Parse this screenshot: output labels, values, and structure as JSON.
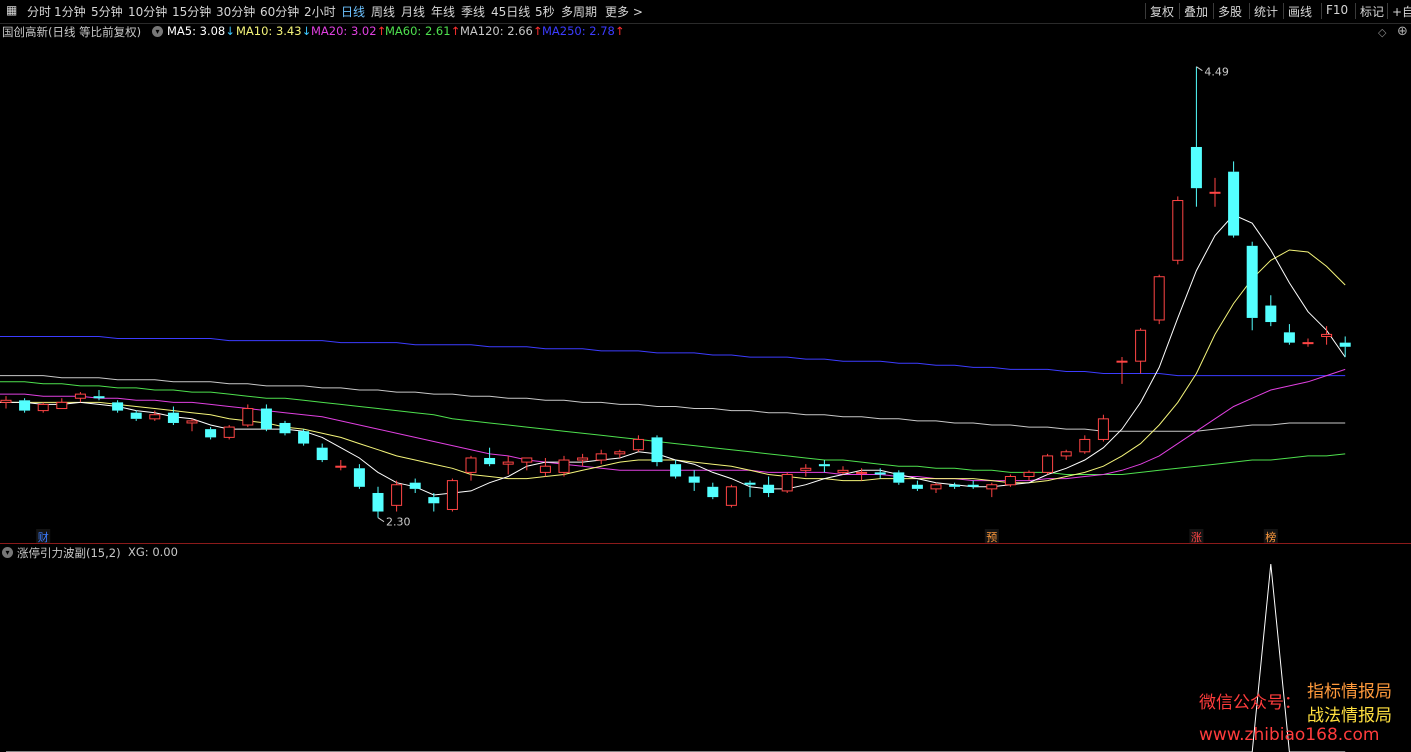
{
  "toolbar": {
    "left": [
      "分时",
      "1分钟",
      "5分钟",
      "10分钟",
      "15分钟",
      "30分钟",
      "60分钟",
      "2小时",
      "日线",
      "周线",
      "月线",
      "年线",
      "季线",
      "45日线",
      "5秒",
      "多周期",
      "更多 >"
    ],
    "active": "日线",
    "right": [
      "复权",
      "叠加",
      "多股",
      "统计",
      "画线",
      "F10",
      "标记",
      "+自"
    ]
  },
  "header": {
    "title": "国创高新(日线 等比前复权)",
    "ma": [
      {
        "label": "MA5: 3.08",
        "arrow": "↓",
        "color": "#ffffff"
      },
      {
        "label": "MA10: 3.43",
        "arrow": "↓",
        "color": "#f4f47a"
      },
      {
        "label": "MA20: 3.02",
        "arrow": "↑",
        "color": "#e040e0"
      },
      {
        "label": "MA60: 2.61",
        "arrow": "↑",
        "color": "#4ee04e"
      },
      {
        "label": "MA120: 2.66",
        "arrow": "↑",
        "color": "#c8c8c8"
      },
      {
        "label": "MA250: 2.78",
        "arrow": "↑",
        "color": "#3c3cff"
      }
    ],
    "arrow_up_color": "#ff3030",
    "arrow_down_color": "#3cc8ff"
  },
  "sub_header": {
    "title": "涨停引力波副(15,2)",
    "value": "XG: 0.00"
  },
  "colors": {
    "up": "#ff4545",
    "down": "#54ffff",
    "ma5": "#ffffff",
    "ma10": "#f4f47a",
    "ma20": "#e040e0",
    "ma60": "#4ee04e",
    "ma120": "#c8c8c8",
    "ma250": "#3c3cff"
  },
  "chart_data": {
    "type": "candlestick",
    "price_labels": {
      "high": "4.49",
      "low": "2.30"
    },
    "events": [
      {
        "index": 2,
        "label": "财",
        "color": "#3c7cff"
      },
      {
        "index": 53,
        "label": "预",
        "color": "#ff9a3c"
      },
      {
        "index": 64,
        "label": "涨",
        "color": "#ff4545"
      },
      {
        "index": 68,
        "label": "榜",
        "color": "#ff9a3c"
      }
    ],
    "candles": [
      [
        2.86,
        2.89,
        2.83,
        2.87
      ],
      [
        2.87,
        2.88,
        2.81,
        2.82
      ],
      [
        2.82,
        2.86,
        2.81,
        2.85
      ],
      [
        2.83,
        2.88,
        2.83,
        2.86
      ],
      [
        2.88,
        2.91,
        2.86,
        2.9
      ],
      [
        2.89,
        2.92,
        2.87,
        2.88
      ],
      [
        2.86,
        2.87,
        2.81,
        2.82
      ],
      [
        2.81,
        2.82,
        2.77,
        2.78
      ],
      [
        2.78,
        2.82,
        2.77,
        2.8
      ],
      [
        2.81,
        2.84,
        2.75,
        2.76
      ],
      [
        2.76,
        2.78,
        2.72,
        2.77
      ],
      [
        2.73,
        2.74,
        2.68,
        2.69
      ],
      [
        2.69,
        2.75,
        2.68,
        2.74
      ],
      [
        2.75,
        2.85,
        2.74,
        2.83
      ],
      [
        2.83,
        2.85,
        2.72,
        2.73
      ],
      [
        2.76,
        2.77,
        2.7,
        2.71
      ],
      [
        2.72,
        2.73,
        2.65,
        2.66
      ],
      [
        2.64,
        2.66,
        2.57,
        2.58
      ],
      [
        2.55,
        2.58,
        2.53,
        2.55
      ],
      [
        2.54,
        2.56,
        2.44,
        2.45
      ],
      [
        2.42,
        2.45,
        2.3,
        2.33
      ],
      [
        2.36,
        2.48,
        2.33,
        2.46
      ],
      [
        2.47,
        2.49,
        2.42,
        2.44
      ],
      [
        2.4,
        2.42,
        2.33,
        2.37
      ],
      [
        2.34,
        2.49,
        2.33,
        2.48
      ],
      [
        2.52,
        2.6,
        2.48,
        2.59
      ],
      [
        2.59,
        2.64,
        2.55,
        2.56
      ],
      [
        2.56,
        2.6,
        2.51,
        2.57
      ],
      [
        2.57,
        2.59,
        2.53,
        2.59
      ],
      [
        2.52,
        2.59,
        2.5,
        2.55
      ],
      [
        2.52,
        2.6,
        2.5,
        2.58
      ],
      [
        2.58,
        2.61,
        2.55,
        2.59
      ],
      [
        2.58,
        2.63,
        2.56,
        2.61
      ],
      [
        2.61,
        2.63,
        2.59,
        2.62
      ],
      [
        2.63,
        2.7,
        2.62,
        2.68
      ],
      [
        2.69,
        2.7,
        2.55,
        2.57
      ],
      [
        2.56,
        2.58,
        2.49,
        2.5
      ],
      [
        2.5,
        2.53,
        2.43,
        2.47
      ],
      [
        2.45,
        2.47,
        2.39,
        2.4
      ],
      [
        2.36,
        2.46,
        2.35,
        2.45
      ],
      [
        2.47,
        2.48,
        2.4,
        2.46
      ],
      [
        2.46,
        2.5,
        2.4,
        2.42
      ],
      [
        2.43,
        2.52,
        2.42,
        2.51
      ],
      [
        2.53,
        2.56,
        2.5,
        2.54
      ],
      [
        2.56,
        2.58,
        2.52,
        2.55
      ],
      [
        2.52,
        2.55,
        2.51,
        2.53
      ],
      [
        2.52,
        2.54,
        2.48,
        2.52
      ],
      [
        2.52,
        2.54,
        2.49,
        2.51
      ],
      [
        2.52,
        2.53,
        2.46,
        2.47
      ],
      [
        2.46,
        2.48,
        2.43,
        2.44
      ],
      [
        2.44,
        2.47,
        2.42,
        2.46
      ],
      [
        2.46,
        2.47,
        2.44,
        2.45
      ],
      [
        2.46,
        2.48,
        2.44,
        2.45
      ],
      [
        2.44,
        2.47,
        2.4,
        2.46
      ],
      [
        2.46,
        2.51,
        2.45,
        2.5
      ],
      [
        2.5,
        2.53,
        2.48,
        2.52
      ],
      [
        2.52,
        2.61,
        2.51,
        2.6
      ],
      [
        2.6,
        2.63,
        2.58,
        2.62
      ],
      [
        2.62,
        2.7,
        2.61,
        2.68
      ],
      [
        2.68,
        2.8,
        2.67,
        2.78
      ],
      [
        3.06,
        3.08,
        2.95,
        3.06
      ],
      [
        3.06,
        3.22,
        3.0,
        3.21
      ],
      [
        3.26,
        3.48,
        3.24,
        3.47
      ],
      [
        3.55,
        3.86,
        3.53,
        3.84
      ],
      [
        4.1,
        4.49,
        3.81,
        3.9
      ],
      [
        3.88,
        3.95,
        3.81,
        3.88
      ],
      [
        3.98,
        4.03,
        3.66,
        3.67
      ],
      [
        3.62,
        3.64,
        3.21,
        3.27
      ],
      [
        3.33,
        3.38,
        3.23,
        3.25
      ],
      [
        3.2,
        3.24,
        3.14,
        3.15
      ],
      [
        3.15,
        3.17,
        3.13,
        3.15
      ],
      [
        3.18,
        3.23,
        3.14,
        3.19
      ],
      [
        3.15,
        3.18,
        3.08,
        3.13
      ]
    ],
    "ma_series": {
      "MA5": [
        2.86,
        2.86,
        2.85,
        2.85,
        2.86,
        2.85,
        2.84,
        2.82,
        2.81,
        2.79,
        2.78,
        2.75,
        2.73,
        2.73,
        2.73,
        2.73,
        2.72,
        2.69,
        2.64,
        2.59,
        2.52,
        2.47,
        2.45,
        2.41,
        2.42,
        2.43,
        2.47,
        2.5,
        2.55,
        2.57,
        2.57,
        2.57,
        2.58,
        2.59,
        2.62,
        2.61,
        2.58,
        2.56,
        2.52,
        2.49,
        2.45,
        2.44,
        2.44,
        2.46,
        2.49,
        2.51,
        2.53,
        2.53,
        2.51,
        2.49,
        2.47,
        2.46,
        2.45,
        2.45,
        2.46,
        2.47,
        2.51,
        2.54,
        2.58,
        2.64,
        2.73,
        2.86,
        3.03,
        3.27,
        3.5,
        3.67,
        3.77,
        3.73,
        3.6,
        3.44,
        3.3,
        3.21,
        3.08
      ],
      "MA10": [
        2.86,
        2.86,
        2.86,
        2.86,
        2.86,
        2.86,
        2.85,
        2.84,
        2.83,
        2.82,
        2.81,
        2.8,
        2.78,
        2.77,
        2.76,
        2.74,
        2.73,
        2.71,
        2.69,
        2.66,
        2.63,
        2.6,
        2.58,
        2.56,
        2.54,
        2.51,
        2.5,
        2.49,
        2.49,
        2.5,
        2.51,
        2.53,
        2.55,
        2.57,
        2.58,
        2.58,
        2.58,
        2.57,
        2.56,
        2.55,
        2.53,
        2.51,
        2.5,
        2.49,
        2.49,
        2.48,
        2.48,
        2.49,
        2.49,
        2.49,
        2.49,
        2.49,
        2.49,
        2.48,
        2.47,
        2.47,
        2.48,
        2.5,
        2.52,
        2.55,
        2.6,
        2.66,
        2.75,
        2.86,
        3.0,
        3.19,
        3.34,
        3.46,
        3.55,
        3.6,
        3.59,
        3.52,
        3.43
      ],
      "MA20": [
        2.9,
        2.9,
        2.89,
        2.89,
        2.89,
        2.88,
        2.88,
        2.87,
        2.87,
        2.86,
        2.86,
        2.85,
        2.84,
        2.83,
        2.82,
        2.81,
        2.8,
        2.79,
        2.77,
        2.75,
        2.73,
        2.71,
        2.69,
        2.67,
        2.65,
        2.63,
        2.61,
        2.6,
        2.58,
        2.57,
        2.56,
        2.55,
        2.54,
        2.53,
        2.53,
        2.53,
        2.53,
        2.53,
        2.53,
        2.53,
        2.53,
        2.52,
        2.52,
        2.52,
        2.52,
        2.51,
        2.51,
        2.51,
        2.5,
        2.5,
        2.49,
        2.49,
        2.48,
        2.48,
        2.48,
        2.48,
        2.49,
        2.49,
        2.5,
        2.51,
        2.53,
        2.56,
        2.6,
        2.66,
        2.72,
        2.78,
        2.84,
        2.88,
        2.92,
        2.94,
        2.96,
        2.99,
        3.02
      ],
      "MA60": [
        2.96,
        2.96,
        2.95,
        2.95,
        2.94,
        2.94,
        2.93,
        2.93,
        2.92,
        2.92,
        2.91,
        2.91,
        2.9,
        2.89,
        2.88,
        2.88,
        2.87,
        2.86,
        2.85,
        2.84,
        2.83,
        2.82,
        2.81,
        2.8,
        2.78,
        2.77,
        2.76,
        2.75,
        2.74,
        2.73,
        2.72,
        2.71,
        2.7,
        2.69,
        2.68,
        2.67,
        2.66,
        2.65,
        2.64,
        2.63,
        2.62,
        2.61,
        2.6,
        2.59,
        2.58,
        2.58,
        2.57,
        2.56,
        2.55,
        2.55,
        2.54,
        2.54,
        2.53,
        2.53,
        2.52,
        2.52,
        2.52,
        2.51,
        2.51,
        2.51,
        2.51,
        2.52,
        2.53,
        2.54,
        2.55,
        2.56,
        2.57,
        2.58,
        2.58,
        2.59,
        2.6,
        2.6,
        2.61
      ],
      "MA120": [
        2.99,
        2.99,
        2.99,
        2.98,
        2.98,
        2.98,
        2.97,
        2.97,
        2.97,
        2.96,
        2.96,
        2.96,
        2.95,
        2.95,
        2.94,
        2.94,
        2.94,
        2.93,
        2.93,
        2.92,
        2.92,
        2.91,
        2.91,
        2.9,
        2.9,
        2.89,
        2.89,
        2.88,
        2.88,
        2.87,
        2.87,
        2.86,
        2.86,
        2.85,
        2.85,
        2.84,
        2.84,
        2.83,
        2.83,
        2.82,
        2.82,
        2.81,
        2.81,
        2.8,
        2.8,
        2.79,
        2.79,
        2.78,
        2.78,
        2.77,
        2.77,
        2.76,
        2.76,
        2.75,
        2.75,
        2.74,
        2.74,
        2.73,
        2.73,
        2.72,
        2.72,
        2.72,
        2.72,
        2.72,
        2.72,
        2.73,
        2.74,
        2.75,
        2.75,
        2.76,
        2.76,
        2.76,
        2.76
      ],
      "MA250": [
        3.18,
        3.18,
        3.18,
        3.18,
        3.18,
        3.18,
        3.17,
        3.17,
        3.17,
        3.17,
        3.17,
        3.17,
        3.16,
        3.16,
        3.16,
        3.16,
        3.16,
        3.16,
        3.15,
        3.15,
        3.15,
        3.15,
        3.14,
        3.14,
        3.14,
        3.14,
        3.13,
        3.13,
        3.13,
        3.12,
        3.12,
        3.12,
        3.11,
        3.11,
        3.11,
        3.1,
        3.1,
        3.1,
        3.09,
        3.09,
        3.08,
        3.08,
        3.08,
        3.07,
        3.07,
        3.06,
        3.06,
        3.06,
        3.05,
        3.05,
        3.04,
        3.04,
        3.03,
        3.03,
        3.02,
        3.02,
        3.02,
        3.01,
        3.01,
        3.0,
        3.0,
        3.0,
        3.0,
        2.99,
        2.99,
        2.99,
        2.99,
        2.99,
        2.99,
        2.99,
        2.99,
        2.99,
        2.99
      ]
    },
    "indicator": {
      "name": "XG",
      "values": [
        0,
        0,
        0,
        0,
        0,
        0,
        0,
        0,
        0,
        0,
        0,
        0,
        0,
        0,
        0,
        0,
        0,
        0,
        0,
        0,
        0,
        0,
        0,
        0,
        0,
        0,
        0,
        0,
        0,
        0,
        0,
        0,
        0,
        0,
        0,
        0,
        0,
        0,
        0,
        0,
        0,
        0,
        0,
        0,
        0,
        0,
        0,
        0,
        0,
        0,
        0,
        0,
        0,
        0,
        0,
        0,
        0,
        0,
        0,
        0,
        0,
        0,
        0,
        0,
        0,
        0,
        0,
        0,
        1,
        0,
        0,
        0,
        0
      ]
    }
  },
  "watermark": {
    "wechat": "微信公众号：",
    "name1": "指标情报局",
    "name2": "战法情报局",
    "url": "www.zhibiao168.com"
  }
}
